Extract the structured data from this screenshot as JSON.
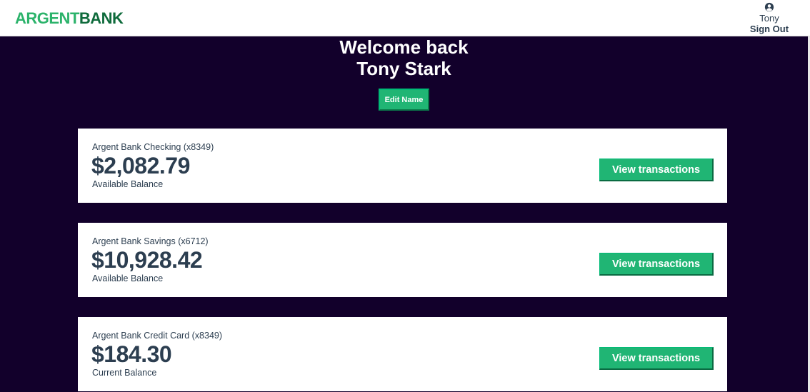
{
  "brand": {
    "part1": "ARGENT",
    "part2": "BANK"
  },
  "user": {
    "name": "Tony",
    "sign_out": "Sign Out"
  },
  "header": {
    "greeting": "Welcome back",
    "full_name": "Tony Stark",
    "edit_button": "Edit Name"
  },
  "accounts": [
    {
      "title": "Argent Bank Checking (x8349)",
      "amount": "$2,082.79",
      "description": "Available Balance",
      "button": "View transactions"
    },
    {
      "title": "Argent Bank Savings (x6712)",
      "amount": "$10,928.42",
      "description": "Available Balance",
      "button": "View transactions"
    },
    {
      "title": "Argent Bank Credit Card (x8349)",
      "amount": "$184.30",
      "description": "Current Balance",
      "button": "View transactions"
    }
  ],
  "colors": {
    "accent": "#20b574",
    "background": "#12002b",
    "text": "#2c3e50"
  },
  "icons": {
    "user": "user-circle-icon"
  }
}
